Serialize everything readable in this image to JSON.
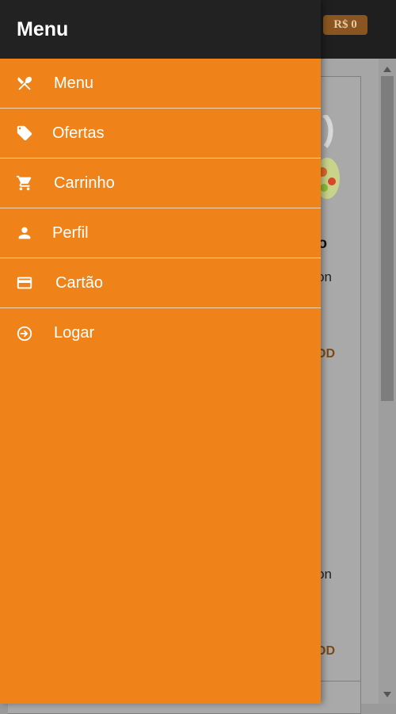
{
  "app": {
    "cart_total": "R$ 0"
  },
  "background": {
    "card1": {
      "title_fragment": "o",
      "desc_fragment": "on",
      "add_fragment": "DD"
    },
    "card2": {
      "desc_fragment": "on",
      "add_fragment": "DD"
    }
  },
  "drawer": {
    "title": "Menu",
    "items": [
      {
        "label": "Menu",
        "icon": "utensils-icon"
      },
      {
        "label": "Ofertas",
        "icon": "tag-icon"
      },
      {
        "label": "Carrinho",
        "icon": "cart-icon"
      },
      {
        "label": "Perfil",
        "icon": "person-icon"
      },
      {
        "label": "Cartão",
        "icon": "credit-card-icon"
      },
      {
        "label": "Logar",
        "icon": "login-icon"
      }
    ]
  },
  "colors": {
    "accent": "#ef8319",
    "header": "#222222",
    "badge": "#8a5520"
  }
}
